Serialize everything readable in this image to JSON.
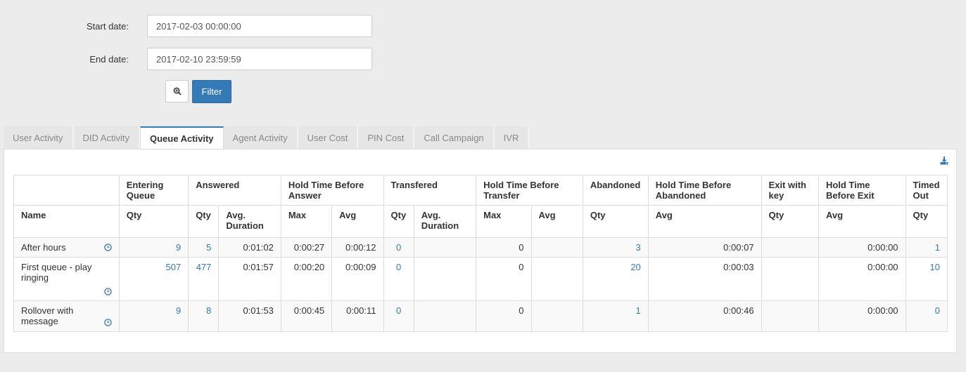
{
  "filters": {
    "start_label": "Start date:",
    "start_value": "2017-02-03 00:00:00",
    "end_label": "End date:",
    "end_value": "2017-02-10 23:59:59",
    "filter_button": "Filter"
  },
  "tabs": [
    {
      "label": "User Activity"
    },
    {
      "label": "DID Activity"
    },
    {
      "label": "Queue Activity"
    },
    {
      "label": "Agent Activity"
    },
    {
      "label": "User Cost"
    },
    {
      "label": "PIN Cost"
    },
    {
      "label": "Call Campaign"
    },
    {
      "label": "IVR"
    }
  ],
  "table": {
    "groups": {
      "entering": "Entering Queue",
      "answered": "Answered",
      "hold_answer": "Hold Time Before Answer",
      "transfered": "Transfered",
      "hold_transfer": "Hold Time Before Transfer",
      "abandoned": "Abandoned",
      "hold_abandoned": "Hold Time Before Abandoned",
      "exit_key": "Exit with key",
      "hold_exit": "Hold Time Before Exit",
      "timed_out": "Timed Out"
    },
    "sub": {
      "name": "Name",
      "qty": "Qty",
      "avg_duration": "Avg. Duration",
      "max": "Max",
      "avg": "Avg"
    },
    "rows": [
      {
        "name": "After hours",
        "entering": "9",
        "ans_qty": "5",
        "ans_avg": "0:01:02",
        "ha_max": "0:00:27",
        "ha_avg": "0:00:12",
        "tr_qty": "0",
        "tr_avg": "",
        "ht_max": "0",
        "ht_avg": "",
        "ab_qty": "3",
        "hab_avg": "0:00:07",
        "ek_qty": "",
        "he_avg": "0:00:00",
        "to_qty": "1"
      },
      {
        "name": "First queue - play ringing",
        "entering": "507",
        "ans_qty": "477",
        "ans_avg": "0:01:57",
        "ha_max": "0:00:20",
        "ha_avg": "0:00:09",
        "tr_qty": "0",
        "tr_avg": "",
        "ht_max": "0",
        "ht_avg": "",
        "ab_qty": "20",
        "hab_avg": "0:00:03",
        "ek_qty": "",
        "he_avg": "0:00:00",
        "to_qty": "10"
      },
      {
        "name": "Rollover with message",
        "entering": "9",
        "ans_qty": "8",
        "ans_avg": "0:01:53",
        "ha_max": "0:00:45",
        "ha_avg": "0:00:11",
        "tr_qty": "0",
        "tr_avg": "",
        "ht_max": "0",
        "ht_avg": "",
        "ab_qty": "1",
        "hab_avg": "0:00:46",
        "ek_qty": "",
        "he_avg": "0:00:00",
        "to_qty": "0"
      }
    ]
  },
  "colors": {
    "accent": "#337ab7"
  }
}
